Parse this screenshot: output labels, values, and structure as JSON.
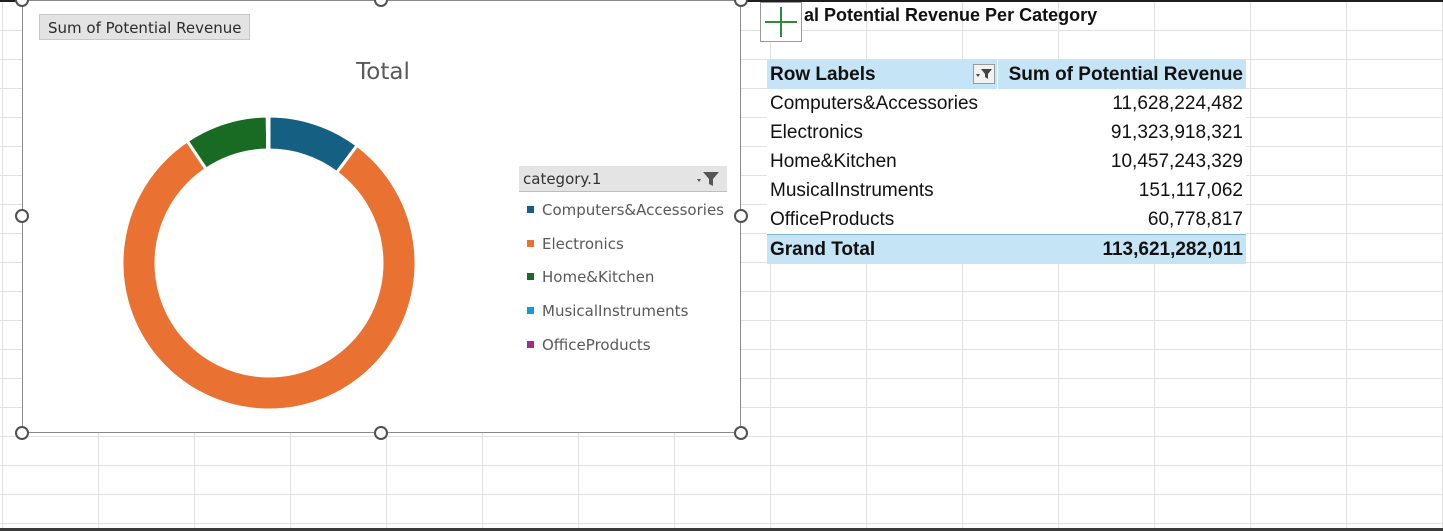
{
  "chart": {
    "field_button": "Sum of Potential Revenue",
    "title": "Total",
    "legend_filter_label": "category.1",
    "legend": [
      {
        "label": "Computers&Accessories",
        "color": "#156082"
      },
      {
        "label": "Electronics",
        "color": "#e97132"
      },
      {
        "label": "Home&Kitchen",
        "color": "#196b24"
      },
      {
        "label": "MusicalInstruments",
        "color": "#0f9ed5"
      },
      {
        "label": "OfficeProducts",
        "color": "#a02b93"
      }
    ]
  },
  "chart_data": {
    "type": "pie",
    "title": "Total",
    "categories": [
      "Computers&Accessories",
      "Electronics",
      "Home&Kitchen",
      "MusicalInstruments",
      "OfficeProducts"
    ],
    "values": [
      11628224482,
      91323918321,
      10457243329,
      151117062,
      60778817
    ],
    "colors": [
      "#156082",
      "#e97132",
      "#196b24",
      "#0f9ed5",
      "#a02b93"
    ],
    "donut": true,
    "legend_position": "right"
  },
  "sheet": {
    "title": "al Potential Revenue Per Category",
    "pivot": {
      "header_label": "Row Labels",
      "header_value": "Sum of Potential Revenue",
      "rows": [
        {
          "label": "Computers&Accessories",
          "value": "11,628,224,482"
        },
        {
          "label": "Electronics",
          "value": "91,323,918,321"
        },
        {
          "label": "Home&Kitchen",
          "value": "10,457,243,329"
        },
        {
          "label": "MusicalInstruments",
          "value": "151,117,062"
        },
        {
          "label": "OfficeProducts",
          "value": "60,778,817"
        }
      ],
      "total_label": "Grand Total",
      "total_value": "113,621,282,011"
    }
  }
}
